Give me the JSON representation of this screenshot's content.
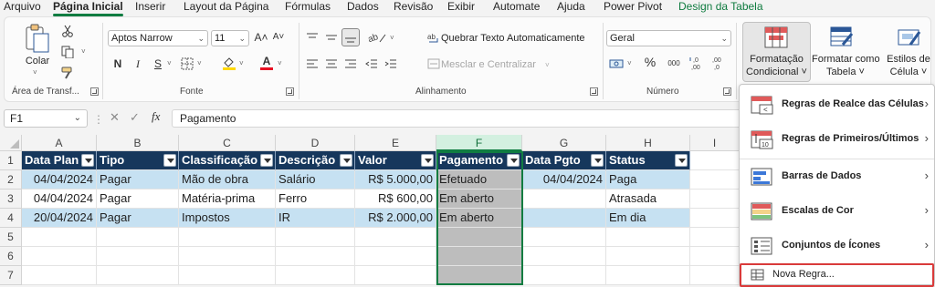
{
  "menu": {
    "tabs": [
      "Arquivo",
      "Página Inicial",
      "Inserir",
      "Layout da Página",
      "Fórmulas",
      "Dados",
      "Revisão",
      "Exibir",
      "Automate",
      "Ajuda",
      "Power Pivot",
      "Design da Tabela"
    ],
    "active": "Página Inicial"
  },
  "ribbon": {
    "clipboard": {
      "paste_label": "Colar",
      "group_label": "Área de Transf..."
    },
    "font": {
      "name": "Aptos Narrow",
      "size": "11",
      "bold": "N",
      "italic": "I",
      "underline": "S",
      "grow": "A˄",
      "shrink": "A˅",
      "color_letter": "A",
      "group_label": "Fonte"
    },
    "alignment": {
      "wrap_text": "Quebrar Texto Automaticamente",
      "merge_center": "Mesclar e Centralizar",
      "group_label": "Alinhamento"
    },
    "number": {
      "format": "Geral",
      "percent": "%",
      "thousands": "000",
      "group_label": "Número"
    },
    "styles": {
      "conditional_format_1": "Formatação",
      "conditional_format_2": "Condicional ˅",
      "format_table_1": "Formatar como",
      "format_table_2": "Tabela ˅",
      "cell_styles_1": "Estilos de",
      "cell_styles_2": "Célula ˅"
    },
    "colors": {
      "font_red": "#e81123",
      "highlight_yellow": "#ffd800",
      "accent_green": "#107c41"
    }
  },
  "formula_bar": {
    "name_box": "F1",
    "fx": "fx",
    "content": "Pagamento"
  },
  "grid": {
    "columns": [
      "A",
      "B",
      "C",
      "D",
      "E",
      "F",
      "G",
      "H",
      "I"
    ],
    "rows": [
      "1",
      "2",
      "3",
      "4",
      "5",
      "6",
      "7"
    ],
    "headers": [
      "Data Plan",
      "Tipo",
      "Classificação",
      "Descrição",
      "Valor",
      "Pagamento",
      "Data Pgto",
      "Status"
    ],
    "data": [
      [
        "04/04/2024",
        "Pagar",
        "Mão de obra",
        "Salário",
        "R$ 5.000,00",
        "Efetuado",
        "04/04/2024",
        "Paga"
      ],
      [
        "04/04/2024",
        "Pagar",
        "Matéria-prima",
        "Ferro",
        "R$ 600,00",
        "Em aberto",
        "",
        "Atrasada"
      ],
      [
        "20/04/2024",
        "Pagar",
        "Impostos",
        "IR",
        "R$ 2.000,00",
        "Em aberto",
        "",
        "Em dia"
      ]
    ],
    "header_color": "#16375c",
    "band_color": "#c6e1f2",
    "selected_column": "F"
  },
  "cf_menu": {
    "items": [
      "Regras de Realce das Células",
      "Regras de Primeiros/Últimos",
      "Barras de Dados",
      "Escalas de Cor",
      "Conjuntos de Ícones"
    ],
    "new_rule": "Nova Regra..."
  }
}
